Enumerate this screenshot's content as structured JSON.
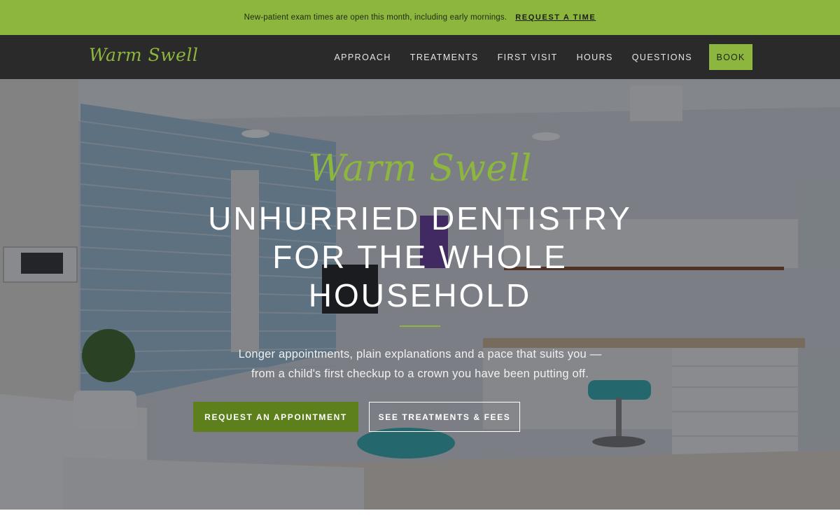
{
  "announcement": {
    "message": "New-patient exam times are open this month, including early mornings.",
    "cta": "REQUEST A TIME"
  },
  "header": {
    "logo": "Warm Swell",
    "nav": [
      "APPROACH",
      "TREATMENTS",
      "FIRST VISIT",
      "HOURS",
      "QUESTIONS"
    ],
    "book_label": "BOOK"
  },
  "hero": {
    "script_title": "Warm Swell",
    "title_lines": [
      "UNHURRIED DENTISTRY",
      "FOR THE WHOLE",
      "HOUSEHOLD"
    ],
    "subtitle_lines": [
      "Longer appointments, plain explanations and a pace that suits you —",
      "from a child's first checkup to a crown you have been putting off."
    ],
    "primary_button": "REQUEST AN APPOINTMENT",
    "secondary_button": "SEE TREATMENTS & FEES"
  },
  "colors": {
    "accent": "#8cb63e",
    "accent_dark": "#5d7f1c",
    "header_bg": "#2a2a2a"
  }
}
